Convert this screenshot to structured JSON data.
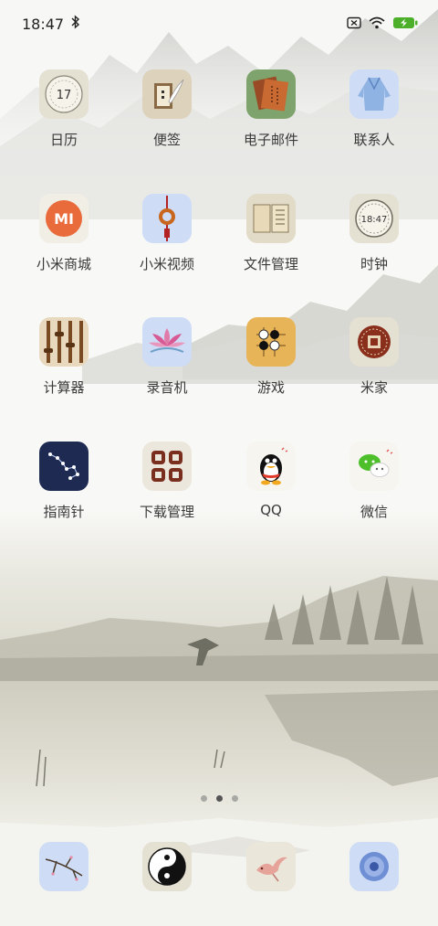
{
  "status_bar": {
    "time": "18:47",
    "bluetooth_icon": "bluetooth-icon",
    "sim_icon": "no-sim-icon",
    "wifi_icon": "wifi-icon",
    "battery_icon": "battery-charging-icon",
    "battery_color": "#4caf2a"
  },
  "apps": [
    {
      "label": "日历",
      "icon": "calendar-icon",
      "text": "17"
    },
    {
      "label": "便签",
      "icon": "notes-icon"
    },
    {
      "label": "电子邮件",
      "icon": "email-icon"
    },
    {
      "label": "联系人",
      "icon": "contacts-icon"
    },
    {
      "label": "小米商城",
      "icon": "mi-store-icon",
      "text": "MI"
    },
    {
      "label": "小米视频",
      "icon": "mi-video-icon"
    },
    {
      "label": "文件管理",
      "icon": "file-manager-icon"
    },
    {
      "label": "时钟",
      "icon": "clock-icon",
      "text": "18:47"
    },
    {
      "label": "计算器",
      "icon": "calculator-icon"
    },
    {
      "label": "录音机",
      "icon": "recorder-icon"
    },
    {
      "label": "游戏",
      "icon": "games-icon"
    },
    {
      "label": "米家",
      "icon": "mijia-icon"
    },
    {
      "label": "指南针",
      "icon": "compass-icon"
    },
    {
      "label": "下载管理",
      "icon": "downloads-icon"
    },
    {
      "label": "QQ",
      "icon": "qq-icon"
    },
    {
      "label": "微信",
      "icon": "wechat-icon"
    }
  ],
  "page_indicator": {
    "count": 3,
    "active": 2
  },
  "dock": [
    {
      "icon": "phone-branch-icon"
    },
    {
      "icon": "yin-yang-icon"
    },
    {
      "icon": "bird-message-icon"
    },
    {
      "icon": "browser-circle-icon"
    }
  ]
}
